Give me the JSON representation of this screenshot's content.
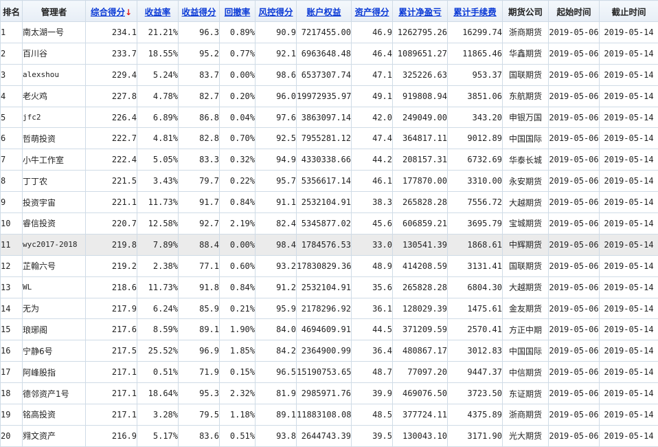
{
  "table": {
    "columns": [
      {
        "label": "排名",
        "sortable": false
      },
      {
        "label": "管理者",
        "sortable": false
      },
      {
        "label": "综合得分",
        "sortable": true,
        "sort_indicator": "↓"
      },
      {
        "label": "收益率",
        "sortable": true
      },
      {
        "label": "收益得分",
        "sortable": true
      },
      {
        "label": "回撤率",
        "sortable": true
      },
      {
        "label": "风控得分",
        "sortable": true
      },
      {
        "label": "账户权益",
        "sortable": true
      },
      {
        "label": "资产得分",
        "sortable": true
      },
      {
        "label": "累计净盈亏",
        "sortable": true
      },
      {
        "label": "累计手续费",
        "sortable": true
      },
      {
        "label": "期货公司",
        "sortable": false
      },
      {
        "label": "起始时间",
        "sortable": false
      },
      {
        "label": "截止时间",
        "sortable": false
      }
    ],
    "rows": [
      {
        "rank": "1",
        "manager": "南太湖一号",
        "score": "234.1",
        "return_rate": "21.21%",
        "return_score": "96.3",
        "drawdown": "0.89%",
        "risk_score": "90.9",
        "equity": "7217455.00",
        "asset_score": "46.9",
        "net_pnl": "1262795.26",
        "fees": "16299.74",
        "company": "浙商期货",
        "start": "2019-05-06",
        "end": "2019-05-14"
      },
      {
        "rank": "2",
        "manager": "百川谷",
        "score": "233.7",
        "return_rate": "18.55%",
        "return_score": "95.2",
        "drawdown": "0.77%",
        "risk_score": "92.1",
        "equity": "6963648.48",
        "asset_score": "46.4",
        "net_pnl": "1089651.27",
        "fees": "11865.46",
        "company": "华鑫期货",
        "start": "2019-05-06",
        "end": "2019-05-14"
      },
      {
        "rank": "3",
        "manager": "alexshou",
        "score": "229.4",
        "return_rate": "5.24%",
        "return_score": "83.7",
        "drawdown": "0.00%",
        "risk_score": "98.6",
        "equity": "6537307.74",
        "asset_score": "47.1",
        "net_pnl": "325226.63",
        "fees": "953.37",
        "company": "国联期货",
        "start": "2019-05-06",
        "end": "2019-05-14"
      },
      {
        "rank": "4",
        "manager": "老火鸡",
        "score": "227.8",
        "return_rate": "4.78%",
        "return_score": "82.7",
        "drawdown": "0.20%",
        "risk_score": "96.0",
        "equity": "19972935.97",
        "asset_score": "49.1",
        "net_pnl": "919808.94",
        "fees": "3851.06",
        "company": "东航期货",
        "start": "2019-05-06",
        "end": "2019-05-14"
      },
      {
        "rank": "5",
        "manager": "jfc2",
        "score": "226.4",
        "return_rate": "6.89%",
        "return_score": "86.8",
        "drawdown": "0.04%",
        "risk_score": "97.6",
        "equity": "3863097.14",
        "asset_score": "42.0",
        "net_pnl": "249049.00",
        "fees": "343.20",
        "company": "申银万国",
        "start": "2019-05-06",
        "end": "2019-05-14"
      },
      {
        "rank": "6",
        "manager": "哲萌投资",
        "score": "222.7",
        "return_rate": "4.81%",
        "return_score": "82.8",
        "drawdown": "0.70%",
        "risk_score": "92.5",
        "equity": "7955281.12",
        "asset_score": "47.4",
        "net_pnl": "364817.11",
        "fees": "9012.89",
        "company": "中国国际",
        "start": "2019-05-06",
        "end": "2019-05-14"
      },
      {
        "rank": "7",
        "manager": "小牛工作室",
        "score": "222.4",
        "return_rate": "5.05%",
        "return_score": "83.3",
        "drawdown": "0.32%",
        "risk_score": "94.9",
        "equity": "4330338.66",
        "asset_score": "44.2",
        "net_pnl": "208157.31",
        "fees": "6732.69",
        "company": "华泰长城",
        "start": "2019-05-06",
        "end": "2019-05-14"
      },
      {
        "rank": "8",
        "manager": "丁丁农",
        "score": "221.5",
        "return_rate": "3.43%",
        "return_score": "79.7",
        "drawdown": "0.22%",
        "risk_score": "95.7",
        "equity": "5356617.14",
        "asset_score": "46.1",
        "net_pnl": "177870.00",
        "fees": "3310.00",
        "company": "永安期货",
        "start": "2019-05-06",
        "end": "2019-05-14"
      },
      {
        "rank": "9",
        "manager": "投资宇宙",
        "score": "221.1",
        "return_rate": "11.73%",
        "return_score": "91.7",
        "drawdown": "0.84%",
        "risk_score": "91.1",
        "equity": "2532104.91",
        "asset_score": "38.3",
        "net_pnl": "265828.28",
        "fees": "7556.72",
        "company": "大越期货",
        "start": "2019-05-06",
        "end": "2019-05-14"
      },
      {
        "rank": "10",
        "manager": "睿信投资",
        "score": "220.7",
        "return_rate": "12.58%",
        "return_score": "92.7",
        "drawdown": "2.19%",
        "risk_score": "82.4",
        "equity": "5345877.02",
        "asset_score": "45.6",
        "net_pnl": "606859.21",
        "fees": "3695.79",
        "company": "宝城期货",
        "start": "2019-05-06",
        "end": "2019-05-14"
      },
      {
        "rank": "11",
        "manager": "wyc2017-2018",
        "score": "219.8",
        "return_rate": "7.89%",
        "return_score": "88.4",
        "drawdown": "0.00%",
        "risk_score": "98.4",
        "equity": "1784576.53",
        "asset_score": "33.0",
        "net_pnl": "130541.39",
        "fees": "1868.61",
        "company": "中辉期货",
        "start": "2019-05-06",
        "end": "2019-05-14"
      },
      {
        "rank": "12",
        "manager": "芷翰六号",
        "score": "219.2",
        "return_rate": "2.38%",
        "return_score": "77.1",
        "drawdown": "0.60%",
        "risk_score": "93.2",
        "equity": "17830829.36",
        "asset_score": "48.9",
        "net_pnl": "414208.59",
        "fees": "3131.41",
        "company": "国联期货",
        "start": "2019-05-06",
        "end": "2019-05-14"
      },
      {
        "rank": "13",
        "manager": "WL",
        "score": "218.6",
        "return_rate": "11.73%",
        "return_score": "91.8",
        "drawdown": "0.84%",
        "risk_score": "91.2",
        "equity": "2532104.91",
        "asset_score": "35.6",
        "net_pnl": "265828.28",
        "fees": "6804.30",
        "company": "大越期货",
        "start": "2019-05-06",
        "end": "2019-05-14"
      },
      {
        "rank": "14",
        "manager": "无为",
        "score": "217.9",
        "return_rate": "6.24%",
        "return_score": "85.9",
        "drawdown": "0.21%",
        "risk_score": "95.9",
        "equity": "2178296.92",
        "asset_score": "36.1",
        "net_pnl": "128029.39",
        "fees": "1475.61",
        "company": "金友期货",
        "start": "2019-05-06",
        "end": "2019-05-14"
      },
      {
        "rank": "15",
        "manager": "琅琊阁",
        "score": "217.6",
        "return_rate": "8.59%",
        "return_score": "89.1",
        "drawdown": "1.90%",
        "risk_score": "84.0",
        "equity": "4694609.91",
        "asset_score": "44.5",
        "net_pnl": "371209.59",
        "fees": "2570.41",
        "company": "方正中期",
        "start": "2019-05-06",
        "end": "2019-05-14"
      },
      {
        "rank": "16",
        "manager": "宁静6号",
        "score": "217.5",
        "return_rate": "25.52%",
        "return_score": "96.9",
        "drawdown": "1.85%",
        "risk_score": "84.2",
        "equity": "2364900.99",
        "asset_score": "36.4",
        "net_pnl": "480867.17",
        "fees": "3012.83",
        "company": "中国国际",
        "start": "2019-05-06",
        "end": "2019-05-14"
      },
      {
        "rank": "17",
        "manager": "阿峰股指",
        "score": "217.1",
        "return_rate": "0.51%",
        "return_score": "71.9",
        "drawdown": "0.15%",
        "risk_score": "96.5",
        "equity": "15190753.65",
        "asset_score": "48.7",
        "net_pnl": "77097.20",
        "fees": "9447.37",
        "company": "中信期货",
        "start": "2019-05-06",
        "end": "2019-05-14"
      },
      {
        "rank": "18",
        "manager": "德邻资产1号",
        "score": "217.1",
        "return_rate": "18.64%",
        "return_score": "95.3",
        "drawdown": "2.32%",
        "risk_score": "81.9",
        "equity": "2985971.76",
        "asset_score": "39.9",
        "net_pnl": "469076.50",
        "fees": "3723.50",
        "company": "东证期货",
        "start": "2019-05-06",
        "end": "2019-05-14"
      },
      {
        "rank": "19",
        "manager": "铭高投资",
        "score": "217.1",
        "return_rate": "3.28%",
        "return_score": "79.5",
        "drawdown": "1.18%",
        "risk_score": "89.1",
        "equity": "11883108.08",
        "asset_score": "48.5",
        "net_pnl": "377724.11",
        "fees": "4375.89",
        "company": "浙商期货",
        "start": "2019-05-06",
        "end": "2019-05-14"
      },
      {
        "rank": "20",
        "manager": "翙文资产",
        "score": "216.9",
        "return_rate": "5.17%",
        "return_score": "83.6",
        "drawdown": "0.51%",
        "risk_score": "93.8",
        "equity": "2644743.39",
        "asset_score": "39.5",
        "net_pnl": "130043.10",
        "fees": "3171.90",
        "company": "光大期货",
        "start": "2019-05-06",
        "end": "2019-05-14"
      }
    ],
    "highlighted_row_index": 10
  },
  "colors": {
    "header_link": "#0b3ad6",
    "sort_arrow": "#e21c1c",
    "net_pnl_text": "#e00000",
    "border": "#cfdbe6",
    "highlight_row": "#ebebeb"
  }
}
